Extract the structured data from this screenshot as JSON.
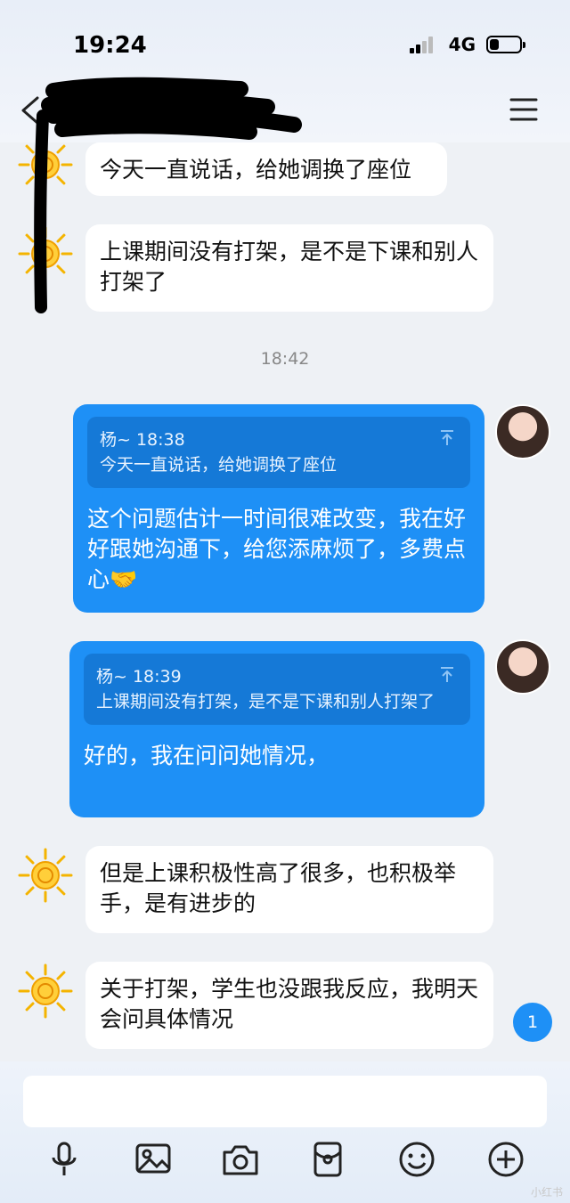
{
  "status_bar": {
    "time": "19:24",
    "network": "4G",
    "battery_level": 0.3
  },
  "header": {
    "back_icon": "chevron-left-icon",
    "menu_icon": "hamburger-menu-icon"
  },
  "messages": [
    {
      "side": "other",
      "avatar": "sun",
      "text": "今天一直说话，给她调换了座位"
    },
    {
      "side": "other",
      "avatar": "sun",
      "text": "上课期间没有打架，是不是下课和别人打架了"
    },
    {
      "side": "time",
      "text": "18:42"
    },
    {
      "side": "me",
      "avatar": "girl",
      "quote_head": "杨~ 18:38",
      "quote_text": "今天一直说话，给她调换了座位",
      "text": "这个问题估计一时间很难改变，我在好好跟她沟通下，给您添麻烦了，多费点心🤝"
    },
    {
      "side": "me",
      "avatar": "girl",
      "quote_head": "杨~ 18:39",
      "quote_text": "上课期间没有打架，是不是下课和别人打架了",
      "text": "好的，我在问问她情况，"
    },
    {
      "side": "other",
      "avatar": "sun",
      "text": "但是上课积极性高了很多，也积极举手，是有进步的"
    },
    {
      "side": "other",
      "avatar": "sun",
      "text": "关于打架，学生也没跟我反应，我明天会问具体情况"
    }
  ],
  "unread_badge": "1",
  "input": {
    "placeholder": ""
  },
  "toolbar": {
    "icons": [
      "microphone-icon",
      "image-icon",
      "camera-icon",
      "red-packet-icon",
      "emoji-icon",
      "plus-icon"
    ]
  },
  "watermark": "小红书",
  "colors": {
    "my_bubble": "#1e90f6",
    "quote_bg": "#1579d7",
    "other_bubble": "#ffffff",
    "background": "#eef1f5"
  }
}
